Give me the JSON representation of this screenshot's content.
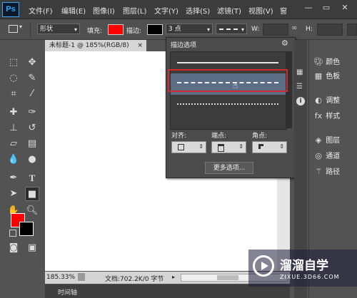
{
  "app": {
    "logo": "Ps"
  },
  "menubar": {
    "items": [
      "文件(F)",
      "编辑(E)",
      "图像(I)",
      "图层(L)",
      "文字(Y)",
      "选择(S)",
      "滤镜(T)",
      "视图(V)",
      "窗"
    ],
    "window_buttons": {
      "minimize": "—",
      "restore": "▭",
      "close": "✕"
    }
  },
  "options": {
    "mode_value": "形状",
    "fill_label": "填充:",
    "fill_color": "#ff0000",
    "stroke_label": "描边:",
    "stroke_color": "#000000",
    "stroke_width": "3 点",
    "w_label": "W:",
    "h_label": "H:"
  },
  "document": {
    "tab_title": "未标题-1 @ 185%(RGB/8)",
    "tab_close": "×",
    "zoom": "185.33%",
    "doc_info": "文档:702.2K/0 字节"
  },
  "timeline": {
    "label": "时间轴"
  },
  "stroke_panel": {
    "title": "描边选项",
    "presets": [
      "solid",
      "dashed",
      "dotted"
    ],
    "selected_preset": "dashed",
    "align_label": "对齐:",
    "caps_label": "端点:",
    "corners_label": "角点:",
    "more_button": "更多选项..."
  },
  "right_panel": {
    "items": [
      "颜色",
      "色板",
      "调整",
      "样式",
      "图层",
      "通道",
      "路径"
    ]
  },
  "colors": {
    "foreground": "#ff0000",
    "background": "#000000",
    "highlight_border": "#d12a2a",
    "selected_row": "#5b6e86"
  },
  "watermark": {
    "title": "溜溜自学",
    "url": "ZIXUE.3D66.COM"
  }
}
